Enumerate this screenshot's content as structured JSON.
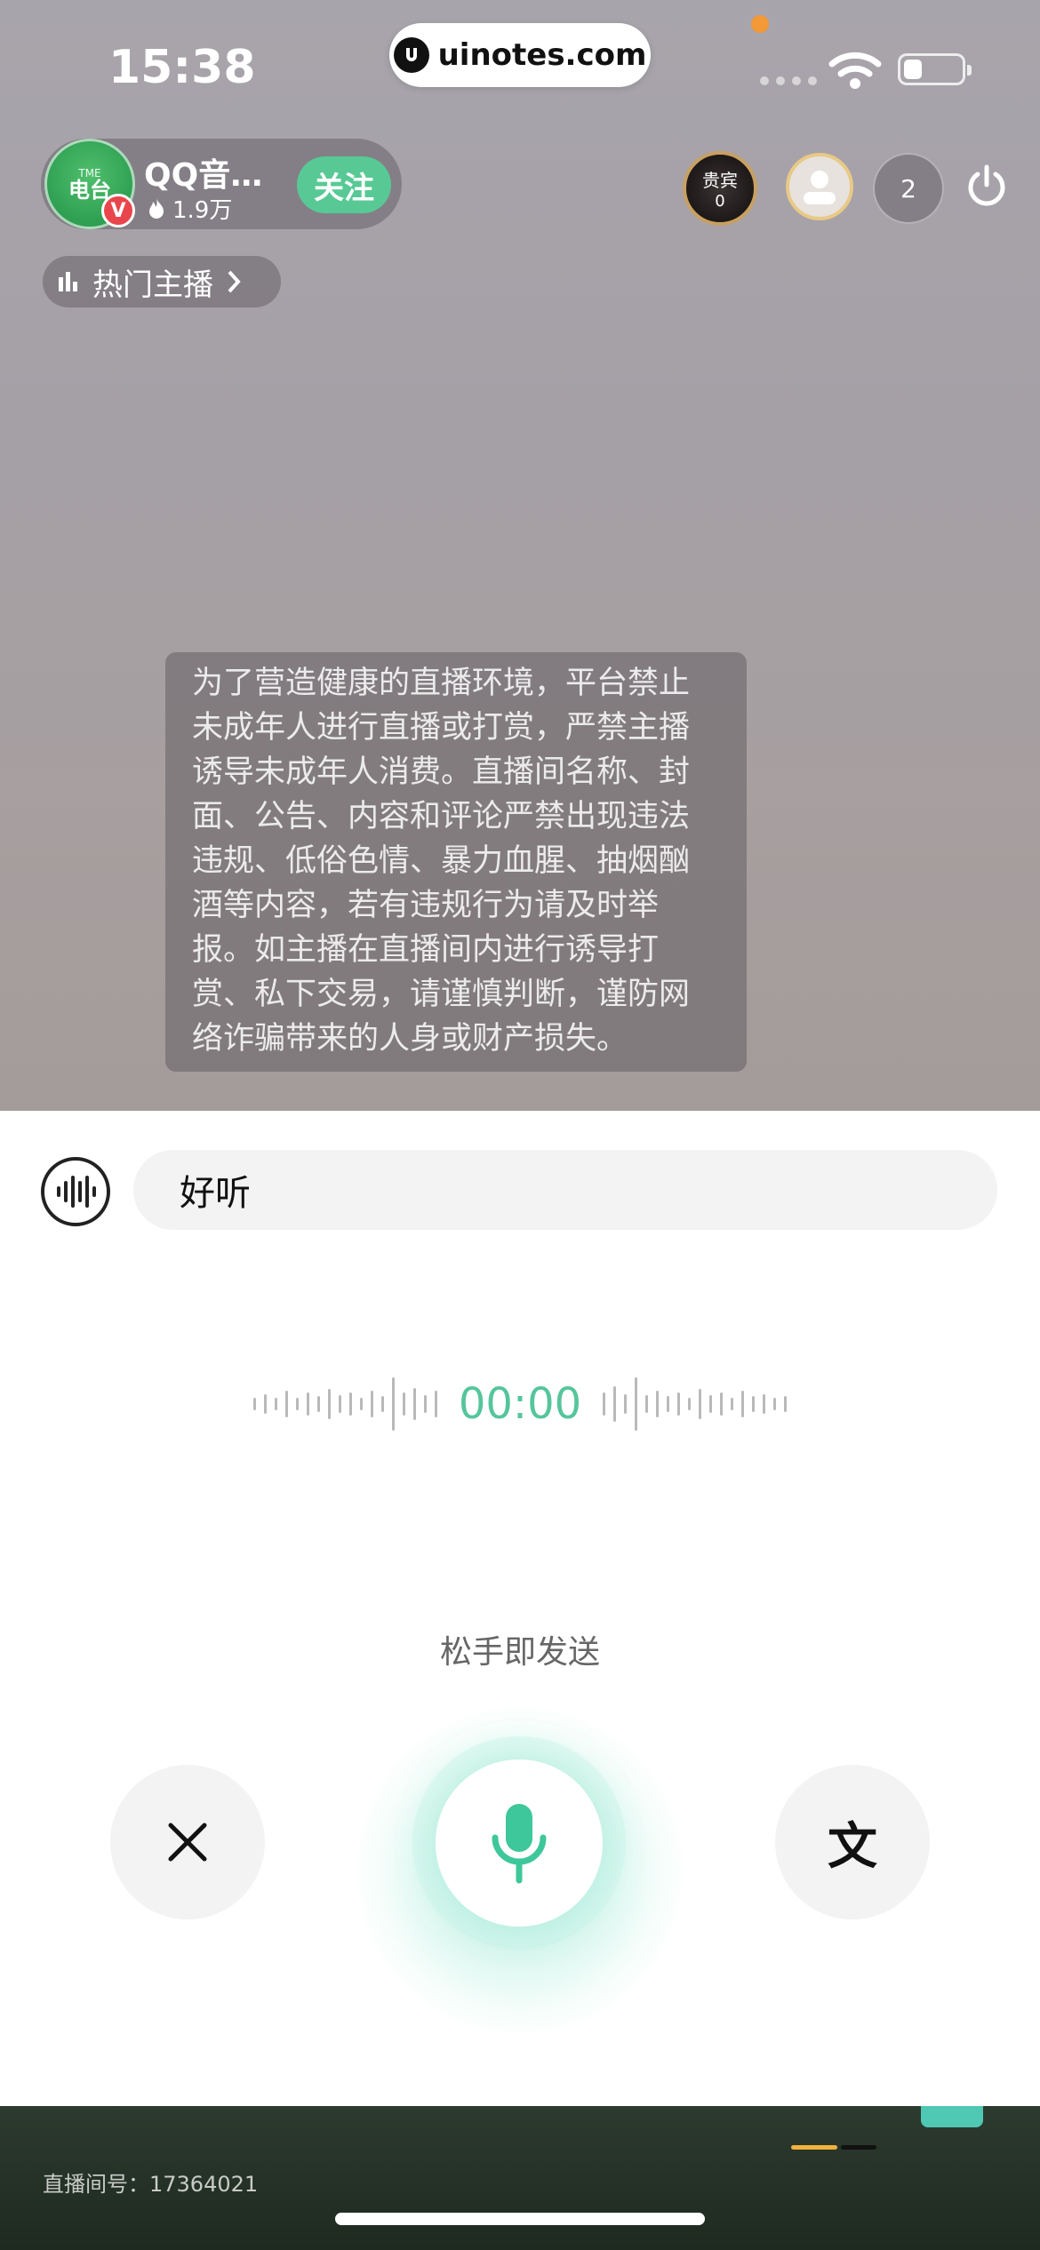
{
  "status_bar": {
    "time": "15:38",
    "url": "uinotes.com"
  },
  "host": {
    "name": "QQ音…",
    "heat": "1.9万",
    "avatar_text_small": "TME",
    "avatar_text": "电台",
    "verified_badge": "V",
    "follow_label": "关注"
  },
  "hot_anchor": {
    "label": "热门主播"
  },
  "viewers": {
    "vip_label": "贵宾",
    "vip_count": "0",
    "online_count": "2"
  },
  "notice": {
    "text": "为了营造健康的直播环境，平台禁止未成年人进行直播或打赏，严禁主播诱导未成年人消费。直播间名称、封面、公告、内容和评论严禁出现违法违规、低俗色情、暴力血腥、抽烟酗酒等内容，若有违规行为请及时举报。如主播在直播间内进行诱导打赏、私下交易，请谨慎判断，谨防网络诈骗带来的人身或财产损失。"
  },
  "voice_input": {
    "text_value": "好听",
    "timer": "00:00",
    "release_hint": "松手即发送",
    "text_mode_label": "文"
  },
  "footer": {
    "room_id": "直播间号：17364021"
  },
  "colors": {
    "accent": "#58c995",
    "timer": "#56c59c",
    "badge_red": "#e8464c"
  }
}
